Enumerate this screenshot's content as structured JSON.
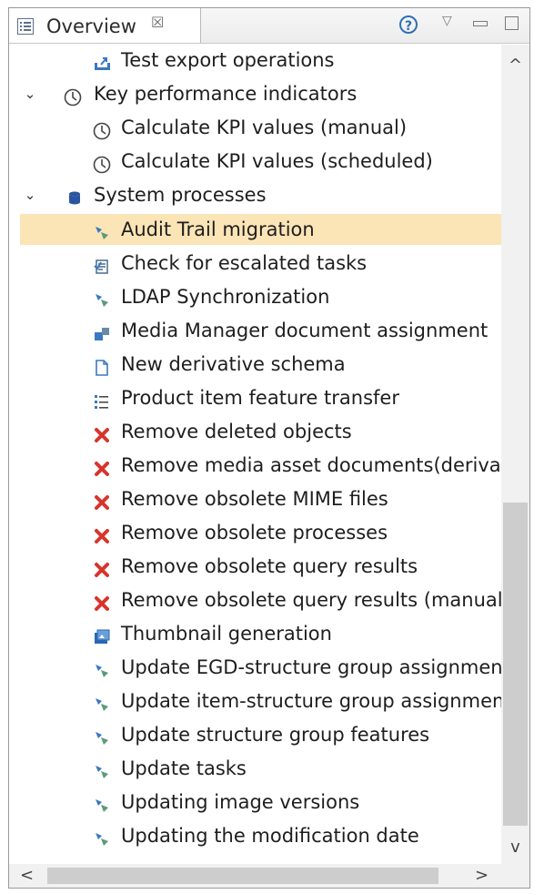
{
  "tab": {
    "title": "Overview",
    "close_glyph": "☒",
    "help_glyph": "?",
    "view_menu_glyph": "▽"
  },
  "colors": {
    "selection": "#fbe4b6",
    "help_blue": "#2f6fb3",
    "remove_red": "#d8342b",
    "process_blue": "#3a78c2"
  },
  "tree": {
    "items": [
      {
        "label": "Test export operations",
        "icon": "export-icon",
        "level": 2
      },
      {
        "label": "Key performance indicators",
        "icon": "clock-icon",
        "level": 1,
        "expanded": true
      },
      {
        "label": "Calculate KPI values (manual)",
        "icon": "clock-icon",
        "level": 2
      },
      {
        "label": "Calculate KPI values (scheduled)",
        "icon": "clock-icon",
        "level": 2
      },
      {
        "label": "System processes",
        "icon": "database-icon",
        "level": 1,
        "expanded": true
      },
      {
        "label": "Audit Trail migration",
        "icon": "process-icon",
        "level": 2,
        "selected": true
      },
      {
        "label": "Check for escalated tasks",
        "icon": "task-icon",
        "level": 2
      },
      {
        "label": "LDAP Synchronization",
        "icon": "process-icon",
        "level": 2
      },
      {
        "label": "Media Manager document assignment",
        "icon": "media-icon",
        "level": 2
      },
      {
        "label": "New derivative schema",
        "icon": "document-icon",
        "level": 2
      },
      {
        "label": "Product item feature transfer",
        "icon": "list-icon",
        "level": 2
      },
      {
        "label": "Remove deleted objects",
        "icon": "remove-icon",
        "level": 2
      },
      {
        "label": "Remove media asset documents(derivat",
        "icon": "remove-icon",
        "level": 2
      },
      {
        "label": "Remove obsolete MIME files",
        "icon": "remove-icon",
        "level": 2
      },
      {
        "label": "Remove obsolete processes",
        "icon": "remove-icon",
        "level": 2
      },
      {
        "label": "Remove obsolete query results",
        "icon": "remove-icon",
        "level": 2
      },
      {
        "label": "Remove obsolete query results (manual)",
        "icon": "remove-icon",
        "level": 2
      },
      {
        "label": "Thumbnail generation",
        "icon": "thumbnail-icon",
        "level": 2
      },
      {
        "label": "Update EGD-structure group assignment",
        "icon": "process-icon",
        "level": 2
      },
      {
        "label": "Update item-structure group assignment",
        "icon": "process-icon",
        "level": 2
      },
      {
        "label": "Update structure group features",
        "icon": "process-icon",
        "level": 2
      },
      {
        "label": "Update tasks",
        "icon": "process-icon",
        "level": 2
      },
      {
        "label": "Updating image versions",
        "icon": "process-icon",
        "level": 2
      },
      {
        "label": "Updating the modification date",
        "icon": "process-icon",
        "level": 2
      }
    ]
  },
  "scrollbar": {
    "up": "^",
    "down": "v",
    "left": "<",
    "right": ">"
  }
}
